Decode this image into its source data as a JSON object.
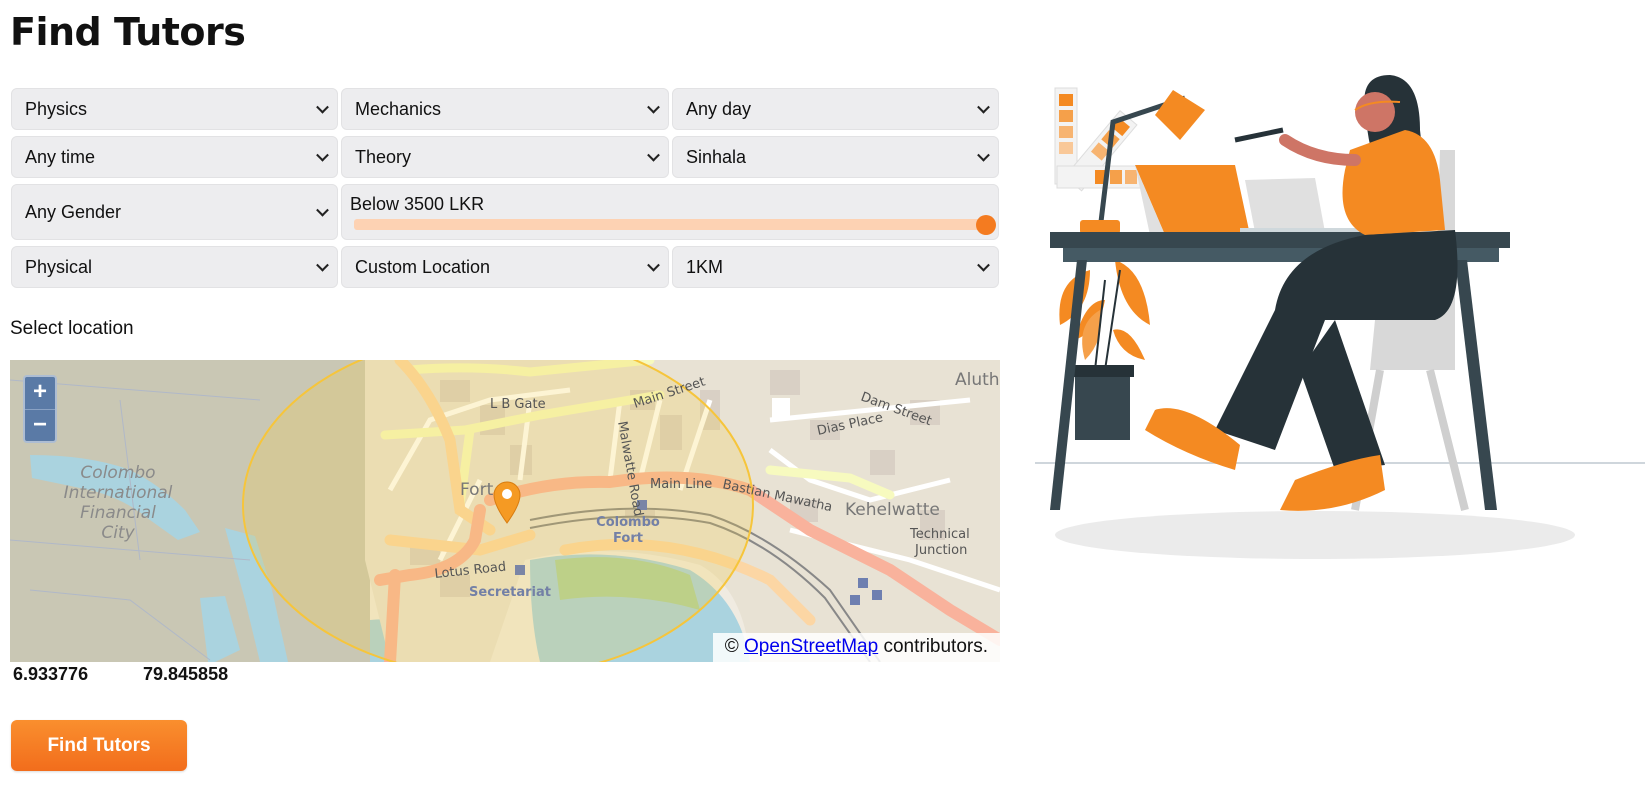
{
  "page": {
    "title": "Find Tutors"
  },
  "filters": {
    "subject": "Physics",
    "topic": "Mechanics",
    "day": "Any day",
    "time": "Any time",
    "class_type": "Theory",
    "language": "Sinhala",
    "gender": "Any Gender",
    "price": {
      "label": "Below 3500 LKR",
      "value_fraction": 1.0
    },
    "mode": "Physical",
    "location_type": "Custom Location",
    "radius": "1KM"
  },
  "map": {
    "section_label": "Select location",
    "zoom_in": "+",
    "zoom_out": "−",
    "attribution_prefix": "©",
    "attribution_link": "OpenStreetMap",
    "attribution_suffix": "contributors.",
    "place_labels": {
      "colombo_intl": "Colombo",
      "international": "International",
      "financial": "Financial",
      "city": "City",
      "lb_gate": "L B Gate",
      "main_street": "Main Street",
      "fort": "Fort",
      "colombo_fort_1": "Colombo",
      "colombo_fort_2": "Fort",
      "lotus_road": "Lotus Road",
      "secretariat": "Secretariat",
      "kehelwatte": "Kehelwatte",
      "technical": "Technical",
      "junction": "Junction",
      "dam_street": "Dam Street",
      "dias_place": "Dias Place",
      "aluthk": "Aluthk",
      "bastian": "Bastian Mawatha",
      "main_line": "Main Line",
      "malwatte": "Malwatte Road"
    }
  },
  "location": {
    "latitude": "6.933776",
    "longitude": "79.845858"
  },
  "actions": {
    "find_label": "Find Tutors"
  },
  "colors": {
    "accent": "#f47b20",
    "field_bg": "#ededef",
    "slider_track": "#fdd2b3"
  }
}
